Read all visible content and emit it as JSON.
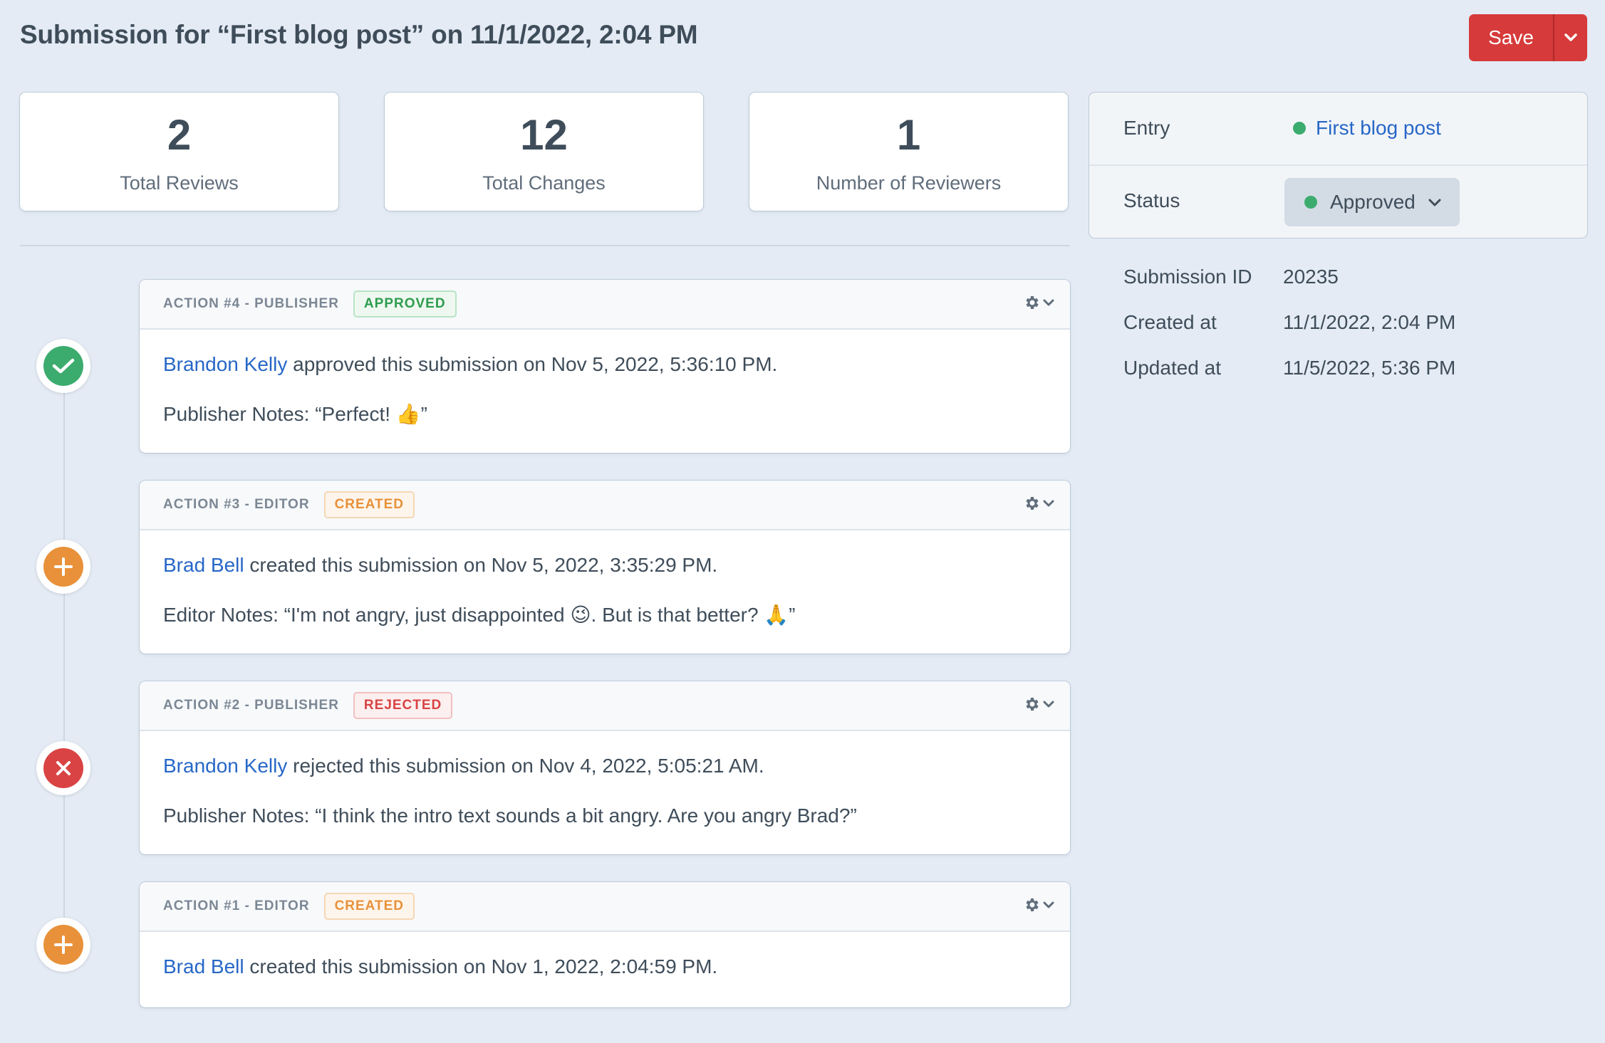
{
  "header": {
    "title": "Submission for “First blog post” on 11/1/2022, 2:04 PM",
    "save_label": "Save"
  },
  "stats": [
    {
      "value": "2",
      "label": "Total Reviews"
    },
    {
      "value": "12",
      "label": "Total Changes"
    },
    {
      "value": "1",
      "label": "Number of Reviewers"
    }
  ],
  "actions": [
    {
      "title": "ACTION #4 - PUBLISHER",
      "badge": "APPROVED",
      "user": "Brandon Kelly",
      "text": " approved this submission on Nov 5, 2022, 5:36:10 PM.",
      "notes": "Publisher Notes: “Perfect! 👍”",
      "icon": "check-icon"
    },
    {
      "title": "ACTION #3 - EDITOR",
      "badge": "CREATED",
      "user": "Brad Bell",
      "text": " created this submission on Nov 5, 2022, 3:35:29 PM.",
      "notes": "Editor Notes: “I'm not angry, just disappointed 😉. But is that better? 🙏”",
      "icon": "plus-icon"
    },
    {
      "title": "ACTION #2 - PUBLISHER",
      "badge": "REJECTED",
      "user": "Brandon Kelly",
      "text": " rejected this submission on Nov 4, 2022, 5:05:21 AM.",
      "notes": "Publisher Notes: “I think the intro text sounds a bit angry. Are you angry Brad?”",
      "icon": "x-icon"
    },
    {
      "title": "ACTION #1 - EDITOR",
      "badge": "CREATED",
      "user": "Brad Bell",
      "text": " created this submission on Nov 1, 2022, 2:04:59 PM.",
      "notes": "",
      "icon": "plus-icon"
    }
  ],
  "side": {
    "entry_label": "Entry",
    "entry_value": "First blog post",
    "status_label": "Status",
    "status_value": "Approved",
    "meta": [
      {
        "label": "Submission ID",
        "value": "20235"
      },
      {
        "label": "Created at",
        "value": "11/1/2022, 2:04 PM"
      },
      {
        "label": "Updated at",
        "value": "11/5/2022, 5:36 PM"
      }
    ]
  },
  "colors": {
    "accent": "#d63a3a",
    "link": "#2767c7",
    "approved": "#3cac6e",
    "created": "#e8913a",
    "rejected": "#d94343"
  }
}
